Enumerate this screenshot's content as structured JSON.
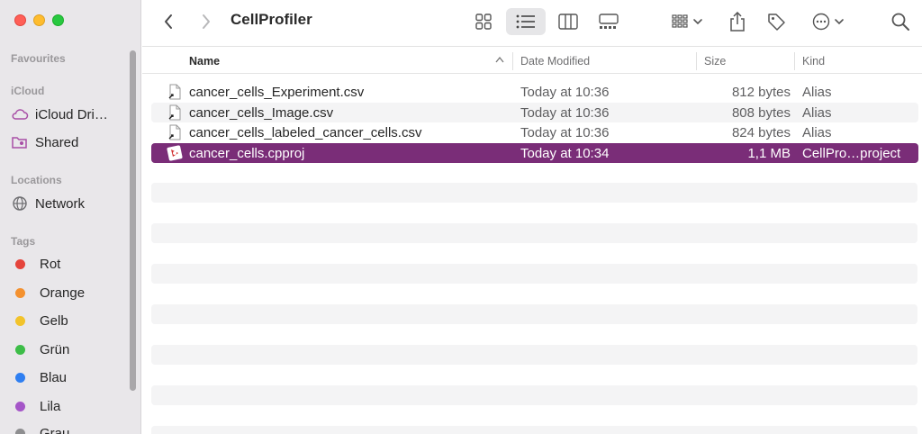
{
  "window": {
    "title": "CellProfiler"
  },
  "sidebar": {
    "sections": {
      "favourites": "Favourites",
      "icloud": "iCloud",
      "locations": "Locations",
      "tags": "Tags"
    },
    "icloud_items": [
      {
        "label": "iCloud Dri…",
        "icon": "cloud-icon"
      },
      {
        "label": "Shared",
        "icon": "shared-folder-icon"
      }
    ],
    "location_items": [
      {
        "label": "Network",
        "icon": "globe-icon"
      }
    ],
    "tags": [
      {
        "label": "Rot",
        "color": "#e5443c"
      },
      {
        "label": "Orange",
        "color": "#f4912f"
      },
      {
        "label": "Gelb",
        "color": "#f2c32b"
      },
      {
        "label": "Grün",
        "color": "#3dbd48"
      },
      {
        "label": "Blau",
        "color": "#2f7ff1"
      },
      {
        "label": "Lila",
        "color": "#a556c8"
      },
      {
        "label": "Grau",
        "color": "#8e8e90"
      }
    ]
  },
  "toolbar": {
    "back": "chevron-left-icon",
    "forward": "chevron-right-icon",
    "views": [
      "icon-view-icon",
      "list-view-icon",
      "column-view-icon",
      "gallery-view-icon"
    ],
    "active_view": "list-view-icon"
  },
  "columns": {
    "name": "Name",
    "date": "Date Modified",
    "size": "Size",
    "kind": "Kind"
  },
  "files": [
    {
      "name": "cancer_cells_Experiment.csv",
      "date": "Today at 10:36",
      "size": "812 bytes",
      "kind": "Alias",
      "icon": "alias-document-icon"
    },
    {
      "name": "cancer_cells_Image.csv",
      "date": "Today at 10:36",
      "size": "808 bytes",
      "kind": "Alias",
      "icon": "alias-document-icon"
    },
    {
      "name": "cancer_cells_labeled_cancer_cells.csv",
      "date": "Today at 10:36",
      "size": "824 bytes",
      "kind": "Alias",
      "icon": "alias-document-icon"
    },
    {
      "name": "cancer_cells.cpproj",
      "date": "Today at 10:34",
      "size": "1,1 MB",
      "kind": "CellPro…project",
      "icon": "cellprofiler-project-icon",
      "selected": true
    }
  ],
  "colors": {
    "selection": "#7a2d78",
    "sidebar": "#e9e7ea"
  }
}
